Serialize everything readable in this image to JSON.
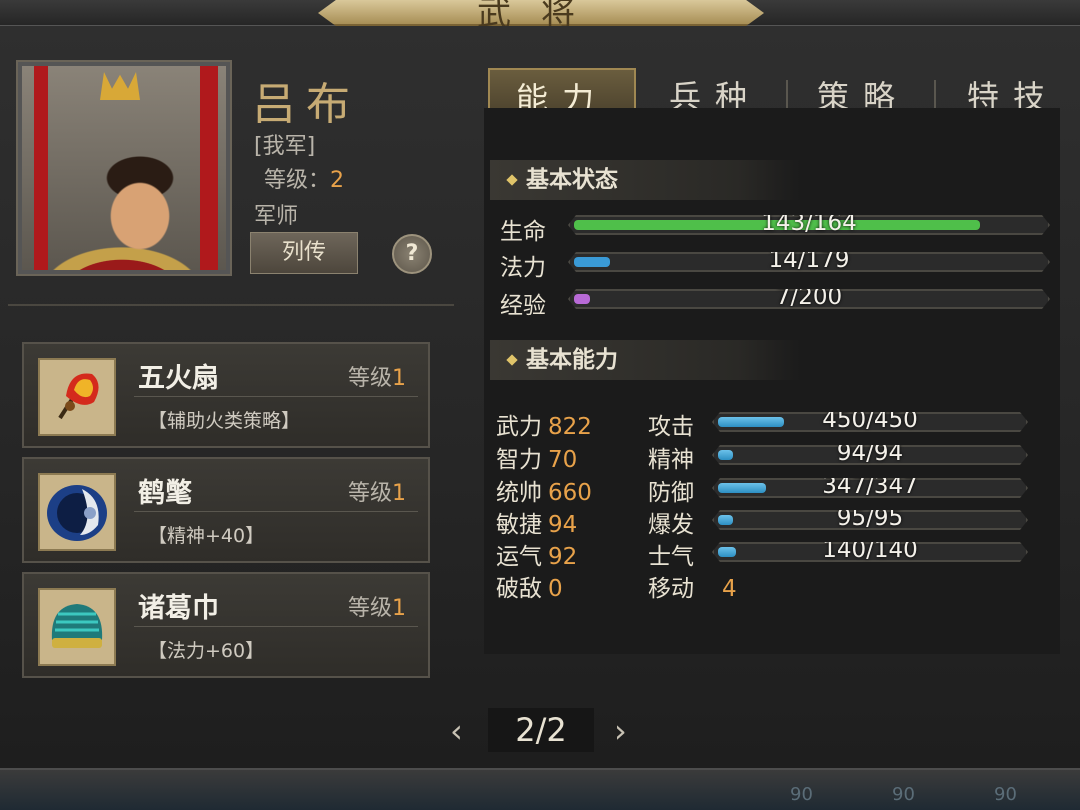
{
  "header": {
    "title": "武将"
  },
  "hero": {
    "name": "吕布",
    "faction": "[我军]",
    "level_label": "等级：",
    "level": "2",
    "role": "军师",
    "biography_button": "列传",
    "help_button": "?"
  },
  "equipment": [
    {
      "name": "五火扇",
      "level_label": "等级",
      "level": "1",
      "desc": "【辅助火类策略】",
      "icon": "fire-fan-icon"
    },
    {
      "name": "鹤氅",
      "level_label": "等级",
      "level": "1",
      "desc": "【精神+40】",
      "icon": "crane-cloak-icon"
    },
    {
      "name": "诸葛巾",
      "level_label": "等级",
      "level": "1",
      "desc": "【法力+60】",
      "icon": "zhuge-scarf-icon"
    }
  ],
  "tabs": [
    "能力",
    "兵种",
    "策略",
    "特技"
  ],
  "active_tab": "能力",
  "status": {
    "title": "基本状态",
    "hp": {
      "label": "生命",
      "current": 143,
      "max": 164,
      "text": "143/164",
      "color": "#4fbf4a"
    },
    "mp": {
      "label": "法力",
      "current": 14,
      "max": 179,
      "text": "14/179",
      "color": "#3a9ad6"
    },
    "exp": {
      "label": "经验",
      "current": 7,
      "max": 200,
      "text": "7/200",
      "color": "#b86ad6"
    }
  },
  "abilities": {
    "title": "基本能力",
    "base": [
      {
        "label": "武力",
        "value": "822"
      },
      {
        "label": "智力",
        "value": "70"
      },
      {
        "label": "统帅",
        "value": "660"
      },
      {
        "label": "敏捷",
        "value": "94"
      },
      {
        "label": "运气",
        "value": "92"
      },
      {
        "label": "破敌",
        "value": "0"
      }
    ],
    "derived": [
      {
        "label": "攻击",
        "text": "450/450",
        "fill": 0.22
      },
      {
        "label": "精神",
        "text": "94/94",
        "fill": 0.05
      },
      {
        "label": "防御",
        "text": "347/347",
        "fill": 0.16
      },
      {
        "label": "爆发",
        "text": "95/95",
        "fill": 0.05
      },
      {
        "label": "士气",
        "text": "140/140",
        "fill": 0.06
      }
    ],
    "move": {
      "label": "移动",
      "value": "4"
    }
  },
  "pager": {
    "text": "2/2",
    "prev": "‹",
    "next": "›"
  },
  "bottom_numbers": [
    "90",
    "90",
    "90"
  ]
}
